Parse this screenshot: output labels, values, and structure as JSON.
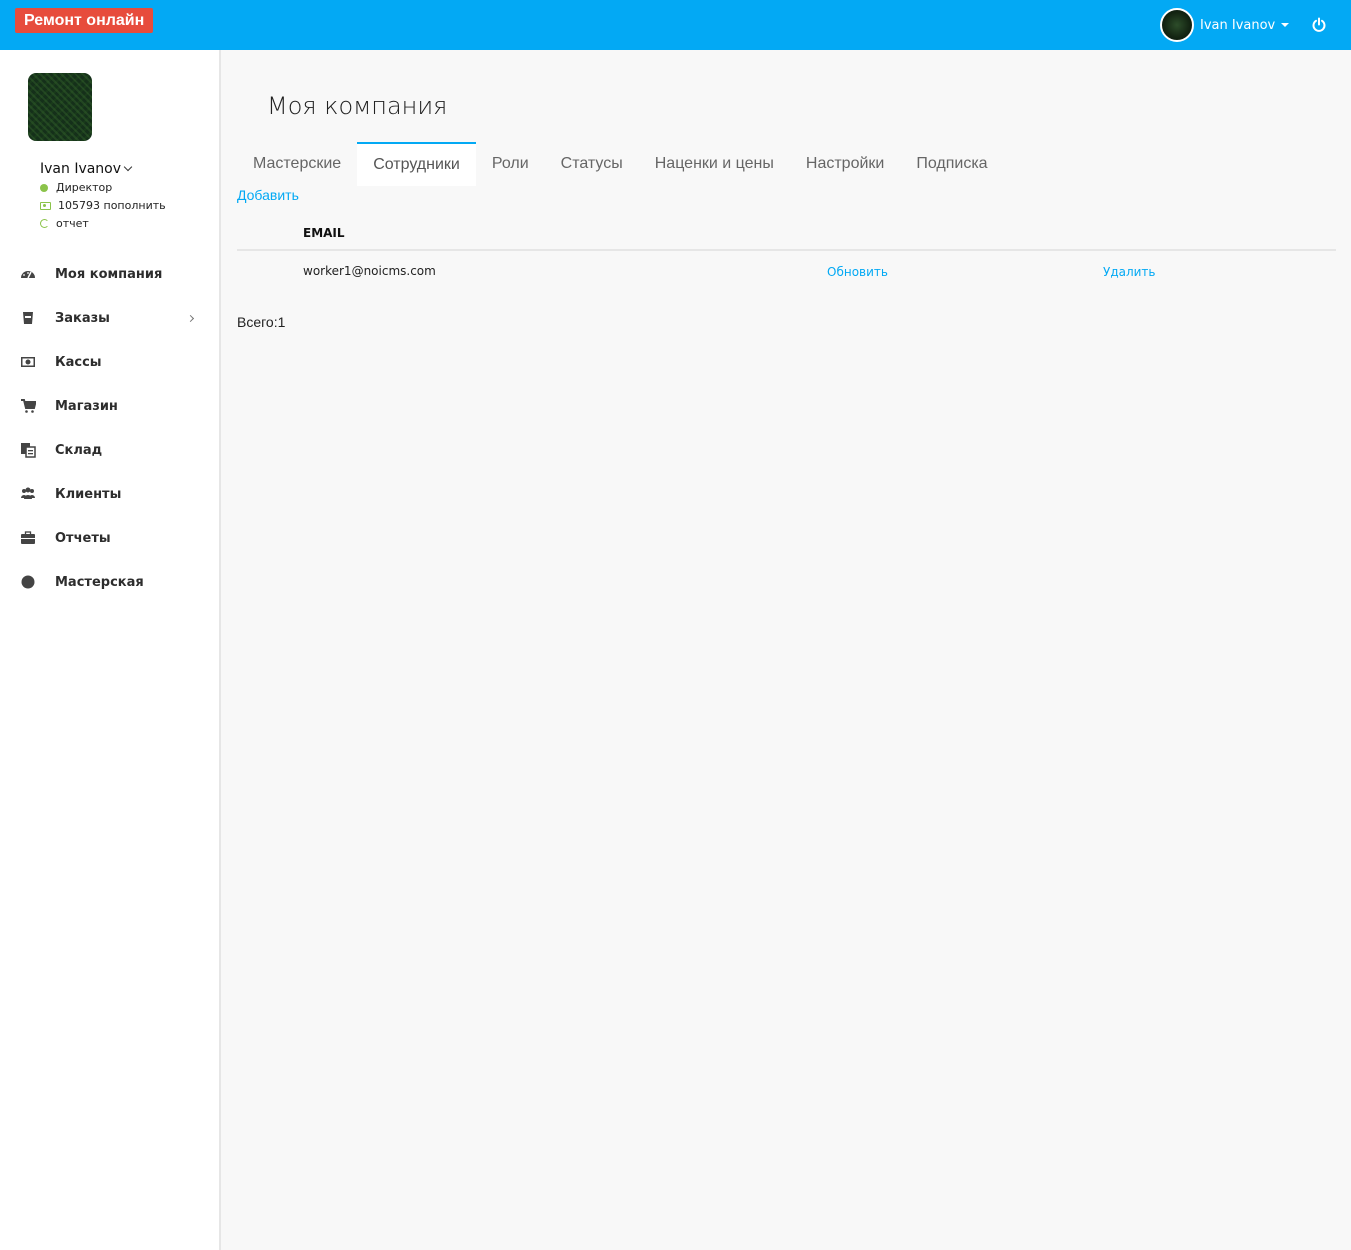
{
  "header": {
    "brand": "Ремонт онлайн",
    "user_name": "Ivan Ivanov",
    "power_icon": "power-icon",
    "bg_color": "#03a9f4",
    "brand_color": "#e74c3c"
  },
  "sidebar": {
    "user_name": "Ivan Ivanov",
    "role": "Директор",
    "balance": "105793",
    "topup": "пополнить",
    "report": "отчет",
    "items": [
      {
        "label": "Моя компания",
        "icon": "dashboard-icon"
      },
      {
        "label": "Заказы",
        "icon": "orders-icon",
        "has_submenu": true
      },
      {
        "label": "Кассы",
        "icon": "cash-icon"
      },
      {
        "label": "Магазин",
        "icon": "cart-icon"
      },
      {
        "label": "Склад",
        "icon": "warehouse-icon"
      },
      {
        "label": "Клиенты",
        "icon": "clients-icon"
      },
      {
        "label": "Отчеты",
        "icon": "briefcase-icon"
      },
      {
        "label": "Мастерская",
        "icon": "circle-icon"
      }
    ]
  },
  "main": {
    "title": "Моя компания",
    "tabs": [
      {
        "label": "Мастерские",
        "active": false
      },
      {
        "label": "Сотрудники",
        "active": true
      },
      {
        "label": "Роли",
        "active": false
      },
      {
        "label": "Статусы",
        "active": false
      },
      {
        "label": "Наценки и цены",
        "active": false
      },
      {
        "label": "Настройки",
        "active": false
      },
      {
        "label": "Подписка",
        "active": false
      }
    ],
    "add_label": "Добавить",
    "table": {
      "header_email": "EMAIL",
      "rows": [
        {
          "email": "worker1@noicms.com",
          "update": "Обновить",
          "delete": "Удалить"
        }
      ]
    },
    "total": "Всего:1"
  }
}
